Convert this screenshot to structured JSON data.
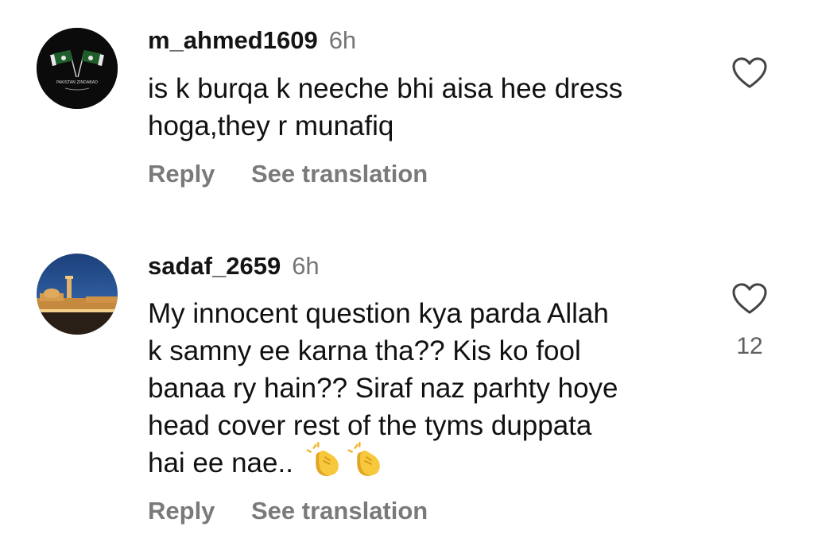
{
  "comments": [
    {
      "username": "m_ahmed1609",
      "time": "6h",
      "lines": [
        "is k burqa k neeche bhi aisa hee dress",
        "hoga,they r munafiq"
      ],
      "reply_label": "Reply",
      "translate_label": "See translation",
      "likes": "",
      "avatar_caption": "PAKISTAN ZINDABAD",
      "avatar_icon": "pakistan-flag-icon"
    },
    {
      "username": "sadaf_2659",
      "time": "6h",
      "lines": [
        "My innocent question  kya parda Allah",
        "k samny ee karna tha?? Kis ko fool",
        "banaa ry hain?? Siraf naz parhty hoye",
        "head cover rest of the tyms duppata",
        "hai ee nae.."
      ],
      "reply_label": "Reply",
      "translate_label": "See translation",
      "likes": "12",
      "avatar_icon": "mosque-night-photo",
      "emoji": [
        "clapping-hands-emoji",
        "clapping-hands-emoji"
      ]
    }
  ],
  "colors": {
    "text": "#111111",
    "secondary": "#7a7a7a",
    "time": "#757575",
    "heart_stroke": "#444444",
    "emoji": "#f5c33b"
  }
}
